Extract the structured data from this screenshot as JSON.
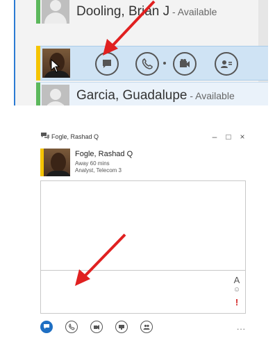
{
  "contact_list": {
    "top_contact": {
      "name": "Dooling, Brian J",
      "status": " - Available"
    },
    "selected_contact": {
      "name": "Fogle, Rashad Q",
      "presence_color": "#f5c400"
    },
    "bottom_contact": {
      "name": "Garcia, Guadalupe",
      "status": " - Available",
      "presence_color": "#5cb85c"
    },
    "actions": [
      "chat-icon",
      "phone-icon",
      "video-icon",
      "contact-card-icon"
    ]
  },
  "conversation_window": {
    "title": "Fogle, Rashad Q",
    "window_controls": {
      "minimize": "–",
      "maximize": "□",
      "close": "×"
    },
    "header": {
      "name": "Fogle, Rashad Q",
      "status": "Away 60 mins",
      "job_title": "Analyst, Telecom 3",
      "presence_color": "#f5c400"
    },
    "compose_tools": {
      "font": "A",
      "emoji": "☺",
      "important": "!"
    },
    "toolbar": {
      "buttons": [
        "im-icon",
        "phone-icon",
        "video-icon",
        "present-icon",
        "participants-icon"
      ],
      "more": "..."
    }
  },
  "colors": {
    "accent": "#1f6fc3",
    "arrow": "#e02020",
    "selection": "#cfe3f4"
  }
}
